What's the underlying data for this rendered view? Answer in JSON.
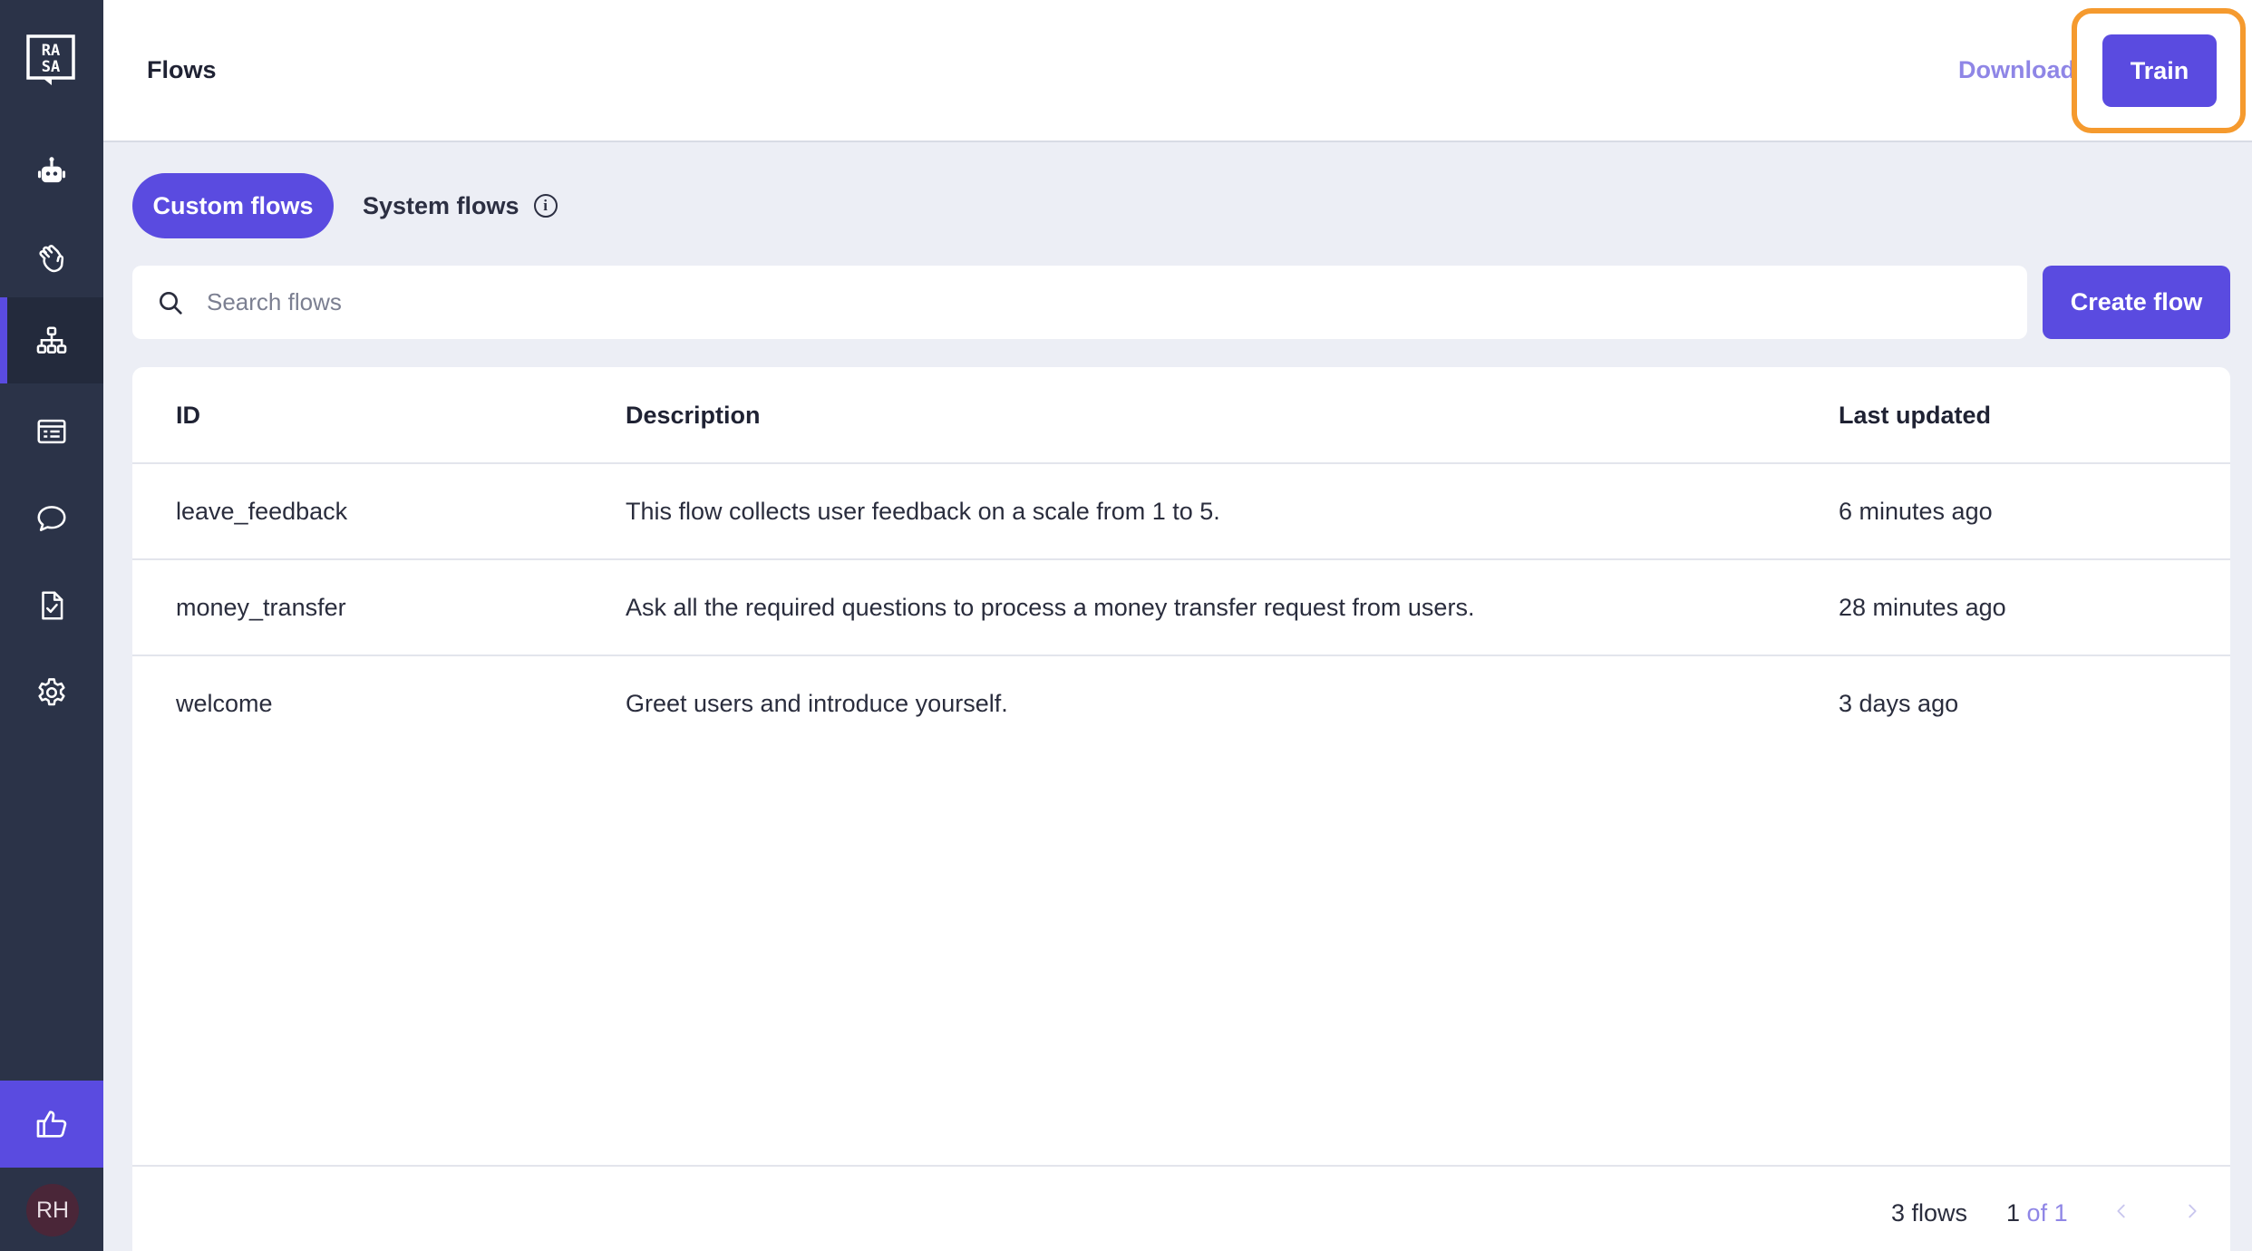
{
  "sidebar": {
    "logo_text": "RASA",
    "items": [
      {
        "icon": "robot-icon"
      },
      {
        "icon": "wave-hand-icon"
      },
      {
        "icon": "flows-icon",
        "active": true
      },
      {
        "icon": "responses-icon"
      },
      {
        "icon": "chat-icon"
      },
      {
        "icon": "checklist-icon"
      },
      {
        "icon": "gear-icon"
      }
    ],
    "feedback_icon": "thumbs-up-icon",
    "avatar_initials": "RH"
  },
  "header": {
    "title": "Flows",
    "download_label": "Download",
    "train_label": "Train"
  },
  "tabs": {
    "custom_label": "Custom flows",
    "system_label": "System flows",
    "info_glyph": "i"
  },
  "search": {
    "placeholder": "Search flows",
    "value": ""
  },
  "create_label": "Create flow",
  "table": {
    "headers": {
      "id": "ID",
      "description": "Description",
      "last_updated": "Last updated"
    },
    "rows": [
      {
        "id": "leave_feedback",
        "description": "This flow collects user feedback on a scale from 1 to 5.",
        "last_updated": "6 minutes ago"
      },
      {
        "id": "money_transfer",
        "description": "Ask all the required questions to process a money transfer request from users.",
        "last_updated": "28 minutes ago"
      },
      {
        "id": "welcome",
        "description": "Greet users and introduce yourself.",
        "last_updated": "3 days ago"
      }
    ]
  },
  "footer": {
    "count": "3 flows",
    "page_current": "1",
    "page_of": "of 1"
  },
  "colors": {
    "accent": "#5a4be0",
    "sidebar": "#2b3348",
    "highlight": "#f59a2e"
  }
}
